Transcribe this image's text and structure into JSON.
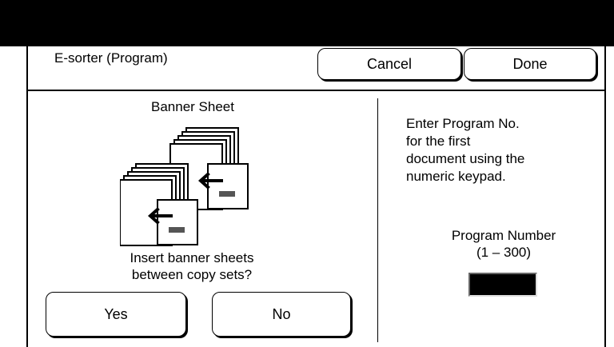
{
  "window": {
    "title": "E-sorter (Program)"
  },
  "header": {
    "cancel_label": "Cancel",
    "done_label": "Done"
  },
  "left": {
    "heading": "Banner Sheet",
    "illustration_icon": "banner-sheet-insert-icon",
    "question_line1": "Insert banner sheets",
    "question_line2": "between copy sets?",
    "yes_label": "Yes",
    "no_label": "No"
  },
  "right": {
    "instruction_line1": "Enter Program No.",
    "instruction_line2": "for the first",
    "instruction_line3": "document using the",
    "instruction_line4": "numeric keypad.",
    "program_label": "Program Number",
    "program_range": "(1 – 300)",
    "program_value": ""
  },
  "colors": {
    "background": "#ffffff",
    "topbar": "#000000",
    "input_fill": "#000000"
  }
}
